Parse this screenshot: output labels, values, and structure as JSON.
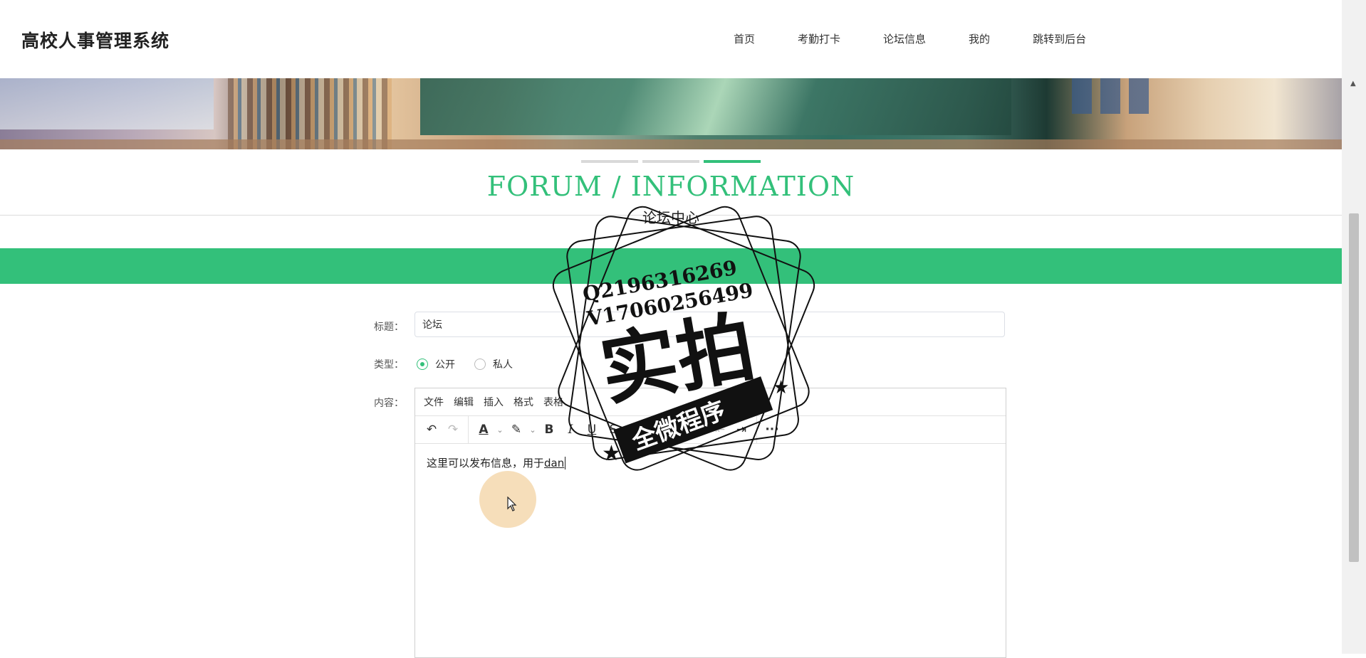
{
  "header": {
    "brand": "高校人事管理系统",
    "nav": [
      "首页",
      "考勤打卡",
      "论坛信息",
      "我的",
      "跳转到后台"
    ]
  },
  "section": {
    "title": "FORUM / INFORMATION",
    "subtitle": "论坛中心"
  },
  "form": {
    "title_label": "标题：",
    "title_value": "论坛",
    "type_label": "类型：",
    "type_options": [
      "公开",
      "私人"
    ],
    "type_selected": "公开",
    "content_label": "内容："
  },
  "editor": {
    "menu": [
      "文件",
      "编辑",
      "插入",
      "格式",
      "表格"
    ],
    "content_text": "这里可以发布信息，用于",
    "content_typing": "dan"
  },
  "watermark": {
    "line1": "Q2196316269",
    "line2": "V17060256499",
    "main": "实拍",
    "ribbon": "全微程序"
  },
  "colors": {
    "accent": "#33c07a"
  }
}
